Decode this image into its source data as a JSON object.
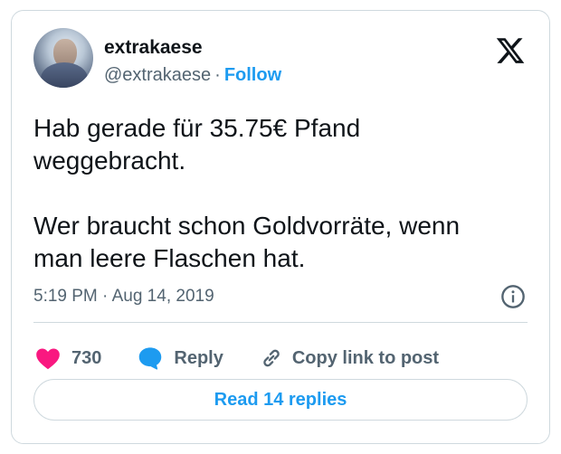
{
  "author": {
    "display_name": "extrakaese",
    "handle": "@extrakaese",
    "separator": "·",
    "follow_label": "Follow",
    "avatar_icon": "user-avatar-photo"
  },
  "platform_icon": "x-logo-icon",
  "tweet": {
    "text": "Hab gerade für 35.75€ Pfand\nweggebracht.\n\nWer braucht schon Goldvorräte, wenn\nman leere Flaschen hat.",
    "timestamp": "5:19 PM · Aug 14, 2019"
  },
  "actions": {
    "like_count": "730",
    "reply_label": "Reply",
    "copy_label": "Copy link to post"
  },
  "read_replies_label": "Read 14 replies",
  "colors": {
    "accent": "#1d9bf0",
    "like": "#f91880",
    "muted": "#536471",
    "text": "#0f1419",
    "border": "#cfd9de"
  }
}
